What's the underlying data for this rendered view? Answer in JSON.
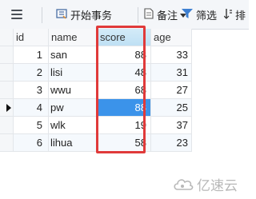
{
  "toolbar": {
    "begin_transaction": "开始事务",
    "notes": "备注",
    "filter": "筛选",
    "sort": "排"
  },
  "columns": [
    "id",
    "name",
    "score",
    "age"
  ],
  "rows": [
    {
      "id": "1",
      "name": "san",
      "score": "88",
      "age": "33"
    },
    {
      "id": "2",
      "name": "lisi",
      "score": "48",
      "age": "31"
    },
    {
      "id": "3",
      "name": "wwu",
      "score": "68",
      "age": "27"
    },
    {
      "id": "4",
      "name": "pw",
      "score": "88",
      "age": "25"
    },
    {
      "id": "5",
      "name": "wlk",
      "score": "19",
      "age": "37"
    },
    {
      "id": "6",
      "name": "lihua",
      "score": "58",
      "age": "23"
    }
  ],
  "watermark": "亿速云",
  "colors": {
    "highlight": "#e03a3a",
    "selected_cell": "#3b93ea",
    "header_active": "#bfe0f4"
  }
}
